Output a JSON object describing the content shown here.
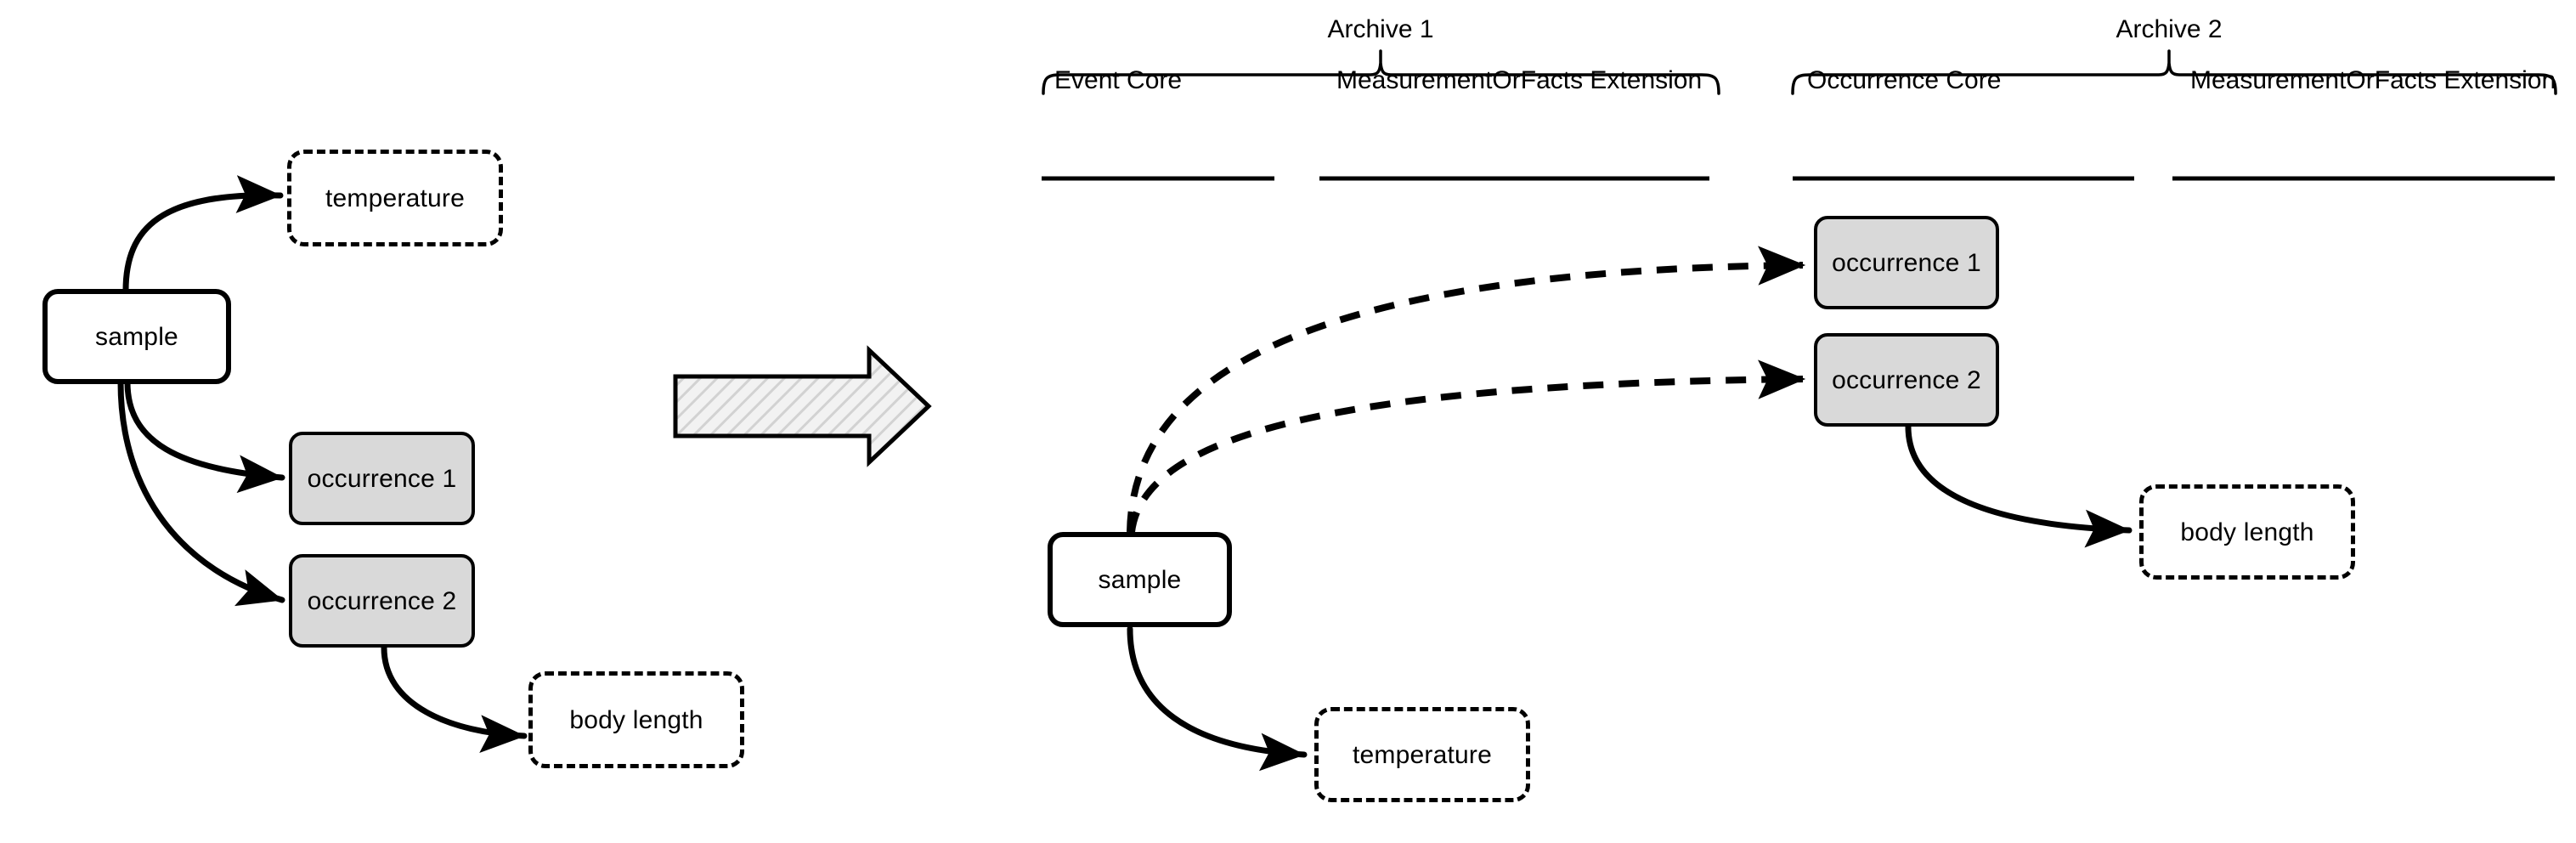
{
  "diagram": {
    "title_left": "",
    "left_panel": {
      "sample": "sample",
      "temperature": "temperature",
      "occurrence_1": "occurrence 1",
      "occurrence_2": "occurrence 2",
      "body_length": "body length"
    },
    "transform_arrow": {
      "name": "transformation-arrow",
      "fill": "#e8e8e8",
      "stroke": "#000000"
    },
    "right_panel": {
      "archives": [
        {
          "label": "Archive 1",
          "columns": [
            "Event Core",
            "MeasurementOrFacts Extension"
          ]
        },
        {
          "label": "Archive 2",
          "columns": [
            "Occurrence Core",
            "MeasurementOrFacts Extension"
          ]
        }
      ],
      "sample": "sample",
      "temperature": "temperature",
      "occurrence_1": "occurrence 1",
      "occurrence_2": "occurrence 2",
      "body_length": "body length"
    },
    "colors": {
      "gray_fill": "#d9d9d9",
      "stroke": "#000000",
      "background": "#ffffff"
    }
  }
}
